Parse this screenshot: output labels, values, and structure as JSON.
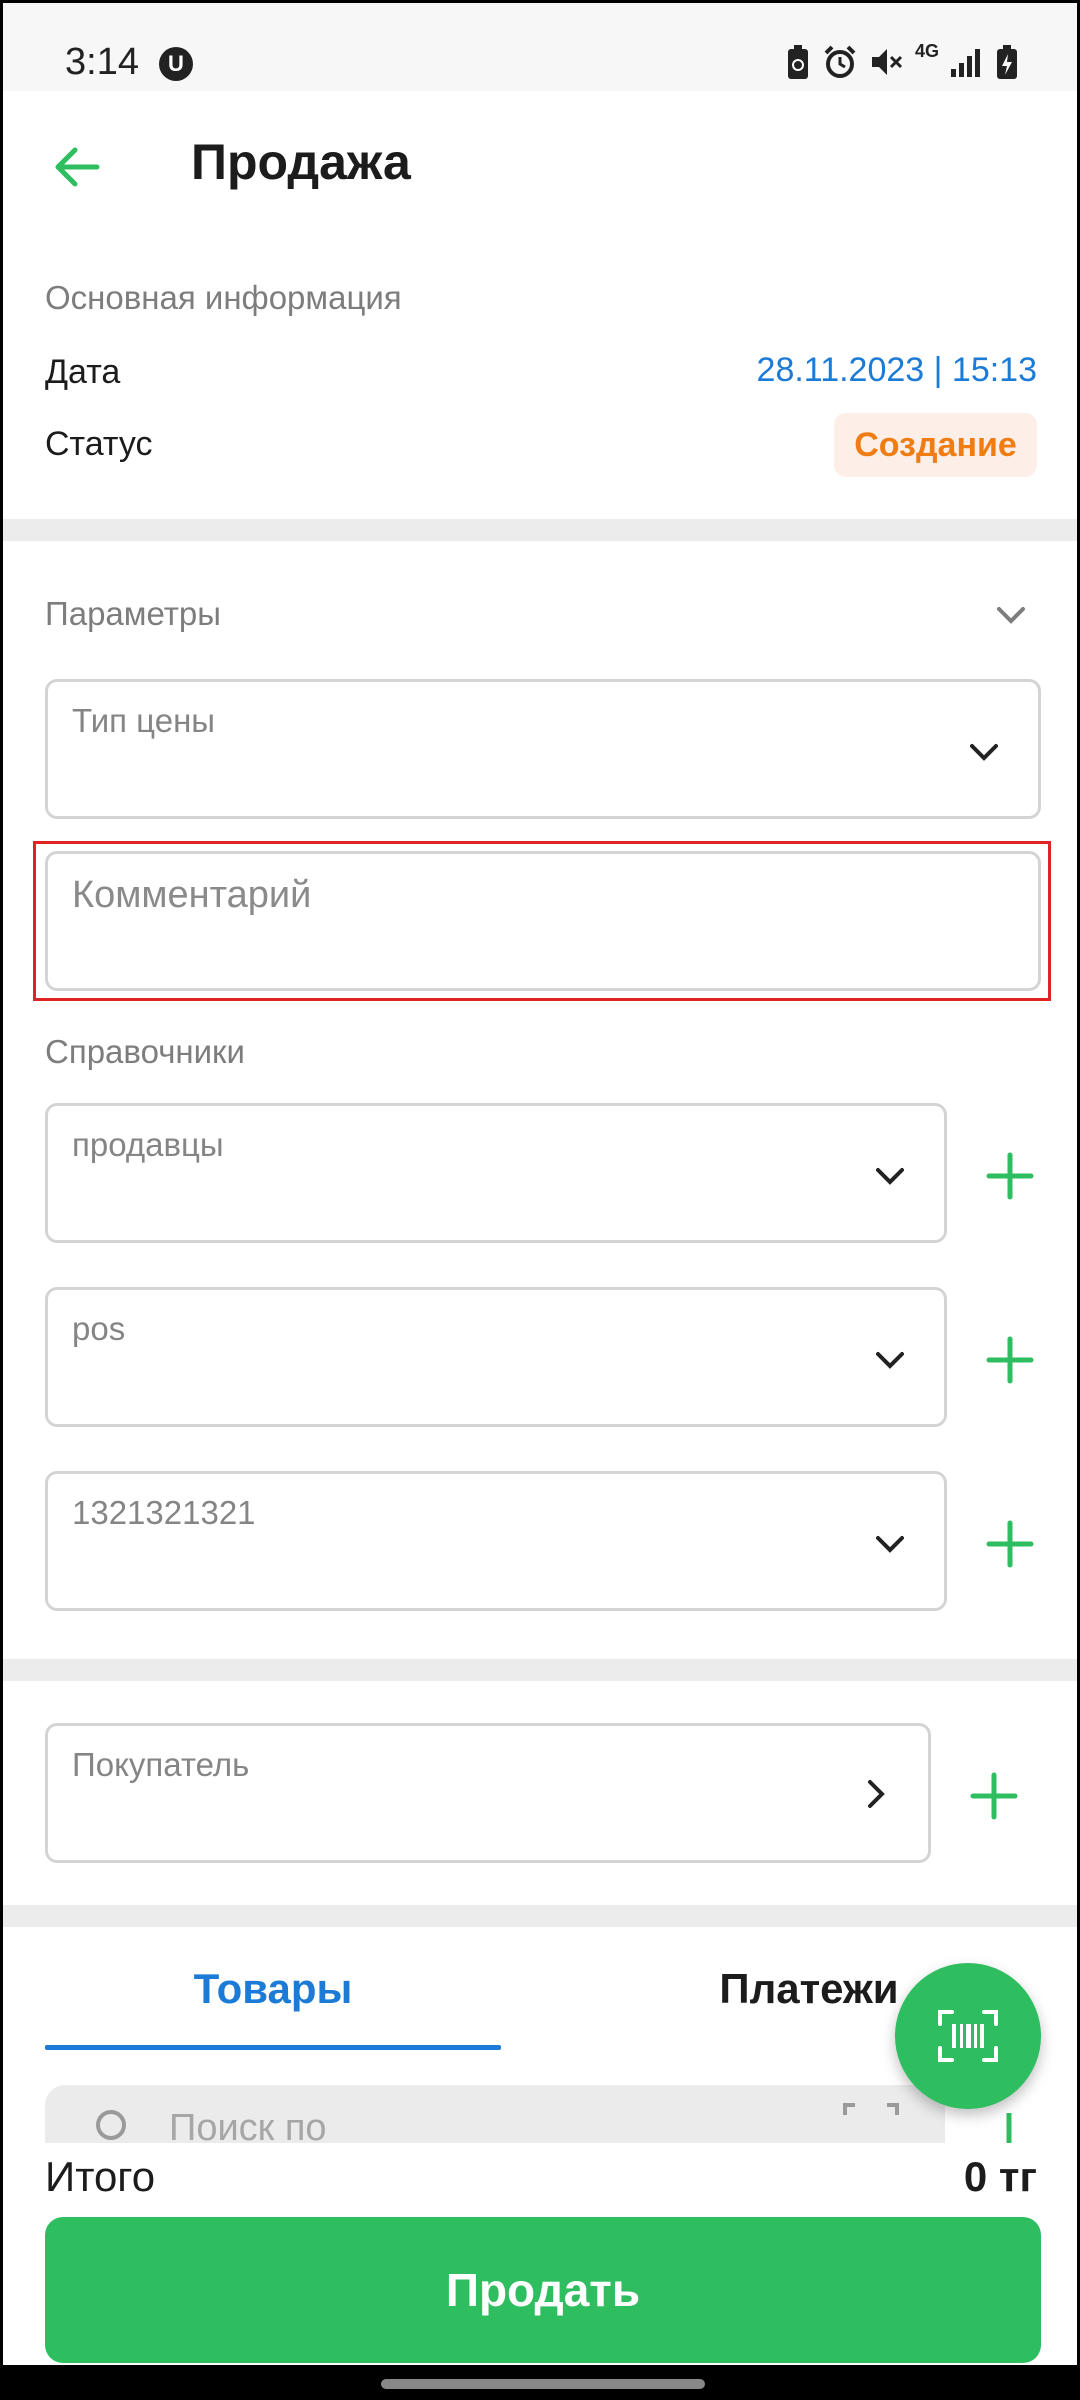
{
  "status_bar": {
    "time": "3:14",
    "network": "4G",
    "icons": [
      "u-icon",
      "recycle-battery-icon",
      "alarm-icon",
      "mute-icon",
      "network-4g-icon",
      "signal-icon",
      "battery-charging-icon"
    ]
  },
  "header": {
    "title": "Продажа",
    "back_icon": "arrow-left-icon"
  },
  "basic_info": {
    "section_label": "Основная информация",
    "date_label": "Дата",
    "date_value": "28.11.2023 | 15:13",
    "status_label": "Статус",
    "status_value": "Создание"
  },
  "parameters": {
    "section_label": "Параметры",
    "price_type_label": "Тип цены",
    "comment_placeholder": "Комментарий"
  },
  "directories": {
    "section_label": "Справочники",
    "items": [
      {
        "label": "продавцы"
      },
      {
        "label": "pos"
      },
      {
        "label": "1321321321"
      }
    ]
  },
  "buyer": {
    "label": "Покупатель"
  },
  "tabs": {
    "items": [
      {
        "label": "Товары",
        "active": true
      },
      {
        "label": "Платежи",
        "active": false
      }
    ]
  },
  "search": {
    "placeholder": "Поиск по"
  },
  "footer": {
    "total_label": "Итого",
    "total_value": "0 тг",
    "sell_label": "Продать"
  },
  "colors": {
    "accent_green": "#2ebd5f",
    "accent_blue": "#1c7bd6",
    "status_orange": "#ef7d14",
    "status_bg": "#fdeee7",
    "highlight_red": "#e02424"
  }
}
